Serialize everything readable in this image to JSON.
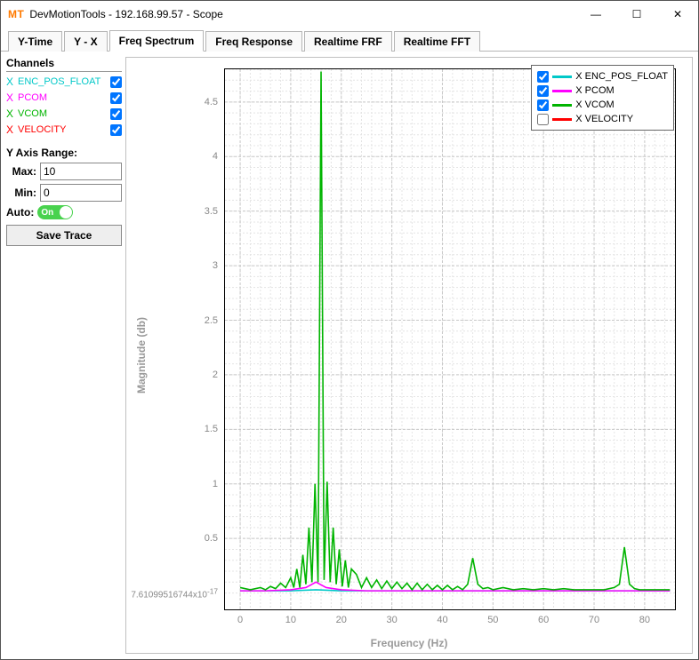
{
  "window": {
    "appicon": "MT",
    "title": "DevMotionTools - 192.168.99.57 - Scope",
    "min": "—",
    "max": "☐",
    "close": "✕"
  },
  "tabs": [
    {
      "label": "Y-Time",
      "active": false
    },
    {
      "label": "Y - X",
      "active": false
    },
    {
      "label": "Freq Spectrum",
      "active": true
    },
    {
      "label": "Freq Response",
      "active": false
    },
    {
      "label": "Realtime FRF",
      "active": false
    },
    {
      "label": "Realtime FFT",
      "active": false
    }
  ],
  "sidebar": {
    "channels_title": "Channels",
    "channels": [
      {
        "axis": "X",
        "name": "ENC_POS_FLOAT",
        "checked": true,
        "color": "#00c8c8"
      },
      {
        "axis": "X",
        "name": "PCOM",
        "checked": true,
        "color": "#ff00ff"
      },
      {
        "axis": "X",
        "name": "VCOM",
        "checked": true,
        "color": "#00b400"
      },
      {
        "axis": "X",
        "name": "VELOCITY",
        "checked": true,
        "color": "#ff0000"
      }
    ],
    "yrange_title": "Y Axis Range:",
    "max_label": "Max:",
    "max_value": "10",
    "min_label": "Min:",
    "min_value": "0",
    "auto_label": "Auto:",
    "auto_state": "On",
    "save_label": "Save Trace"
  },
  "chart": {
    "ylabel": "Magnitude (db)",
    "xlabel": "Frequency (Hz)",
    "y_zero_label": "7.61099516744x10",
    "y_zero_exp": "-17",
    "x_ticks": [
      0,
      10,
      20,
      30,
      40,
      50,
      60,
      70,
      80
    ],
    "x_range": [
      -3,
      86
    ],
    "y_ticks": [
      0.5,
      1,
      1.5,
      2,
      2.5,
      3,
      3.5,
      4,
      4.5
    ],
    "y_range": [
      -0.15,
      4.8
    ],
    "legend": [
      {
        "checked": true,
        "color": "#00c8c8",
        "label": "X ENC_POS_FLOAT"
      },
      {
        "checked": true,
        "color": "#ff00ff",
        "label": "X PCOM"
      },
      {
        "checked": true,
        "color": "#00b400",
        "label": "X VCOM"
      },
      {
        "checked": false,
        "color": "#ff0000",
        "label": "X VELOCITY"
      }
    ]
  },
  "chart_data": {
    "type": "line",
    "title": "",
    "xlabel": "Frequency (Hz)",
    "ylabel": "Magnitude (db)",
    "xlim": [
      -3,
      86
    ],
    "ylim": [
      -0.15,
      4.8
    ],
    "series": [
      {
        "name": "X ENC_POS_FLOAT",
        "color": "#00c8c8",
        "x": [
          0,
          5,
          10,
          15,
          20,
          25,
          30,
          35,
          40,
          45,
          50,
          55,
          60,
          65,
          70,
          75,
          80,
          85
        ],
        "y": [
          0.02,
          0.02,
          0.02,
          0.03,
          0.02,
          0.02,
          0.02,
          0.02,
          0.02,
          0.02,
          0.02,
          0.02,
          0.02,
          0.02,
          0.02,
          0.02,
          0.02,
          0.02
        ]
      },
      {
        "name": "X PCOM",
        "color": "#ff00ff",
        "x": [
          0,
          5,
          10,
          13,
          15,
          17,
          20,
          25,
          30,
          35,
          40,
          45,
          50,
          55,
          60,
          65,
          70,
          75,
          80,
          85
        ],
        "y": [
          0.02,
          0.02,
          0.03,
          0.05,
          0.1,
          0.05,
          0.03,
          0.02,
          0.02,
          0.02,
          0.02,
          0.02,
          0.02,
          0.02,
          0.02,
          0.02,
          0.02,
          0.02,
          0.02,
          0.02
        ]
      },
      {
        "name": "X VCOM",
        "color": "#00b400",
        "x": [
          0,
          2,
          4,
          5,
          6,
          7,
          8,
          9,
          10,
          10.6,
          11.2,
          11.8,
          12.4,
          13,
          13.6,
          14.2,
          14.8,
          15.4,
          16,
          16.6,
          17.2,
          17.8,
          18.4,
          19,
          19.6,
          20.2,
          20.8,
          21.4,
          22,
          23,
          24,
          25,
          26,
          27,
          28,
          29,
          30,
          31,
          32,
          33,
          34,
          35,
          36,
          37,
          38,
          39,
          40,
          41,
          42,
          43,
          44,
          45,
          46,
          47,
          48,
          49,
          50,
          52,
          54,
          56,
          58,
          60,
          62,
          64,
          66,
          68,
          70,
          72,
          74,
          75,
          76,
          77,
          78,
          79,
          80,
          82,
          84,
          85
        ],
        "y": [
          0.05,
          0.03,
          0.05,
          0.03,
          0.06,
          0.04,
          0.09,
          0.05,
          0.14,
          0.05,
          0.22,
          0.05,
          0.35,
          0.08,
          0.6,
          0.1,
          1.0,
          0.1,
          4.78,
          0.12,
          1.02,
          0.1,
          0.6,
          0.08,
          0.4,
          0.06,
          0.3,
          0.05,
          0.22,
          0.17,
          0.05,
          0.14,
          0.05,
          0.12,
          0.04,
          0.11,
          0.04,
          0.1,
          0.04,
          0.09,
          0.03,
          0.09,
          0.03,
          0.08,
          0.03,
          0.07,
          0.03,
          0.07,
          0.03,
          0.06,
          0.03,
          0.08,
          0.32,
          0.08,
          0.04,
          0.05,
          0.03,
          0.05,
          0.03,
          0.04,
          0.03,
          0.04,
          0.03,
          0.04,
          0.03,
          0.03,
          0.03,
          0.03,
          0.05,
          0.08,
          0.42,
          0.08,
          0.04,
          0.03,
          0.03,
          0.03,
          0.03,
          0.03
        ]
      }
    ]
  }
}
